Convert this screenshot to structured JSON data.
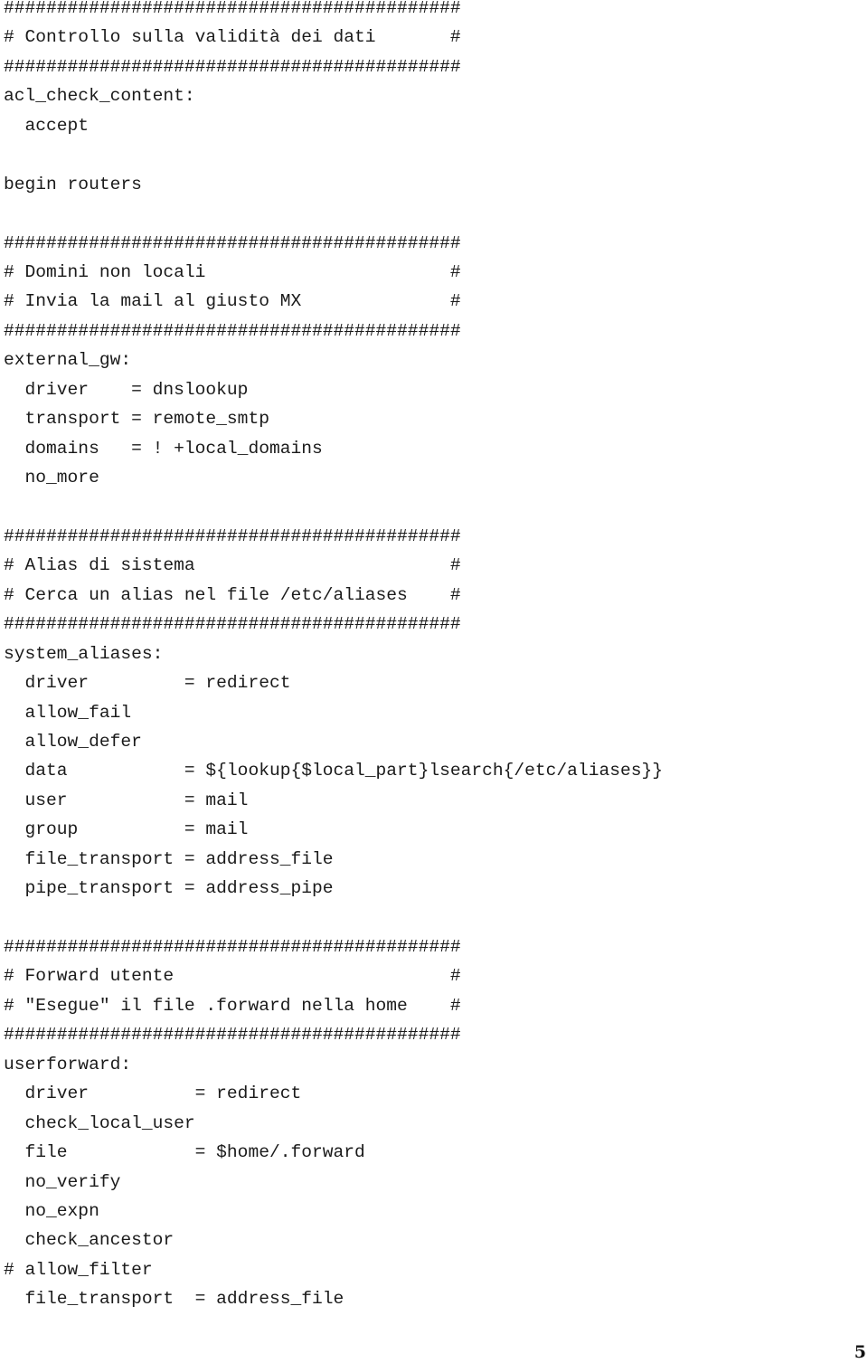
{
  "document": {
    "lines": [
      "###########################################",
      "# Controllo sulla validità dei dati       #",
      "###########################################",
      "acl_check_content:",
      "  accept",
      "",
      "begin routers",
      "",
      "###########################################",
      "# Domini non locali                       #",
      "# Invia la mail al giusto MX              #",
      "###########################################",
      "external_gw:",
      "  driver    = dnslookup",
      "  transport = remote_smtp",
      "  domains   = ! +local_domains",
      "  no_more",
      "",
      "###########################################",
      "# Alias di sistema                        #",
      "# Cerca un alias nel file /etc/aliases    #",
      "###########################################",
      "system_aliases:",
      "  driver         = redirect",
      "  allow_fail",
      "  allow_defer",
      "  data           = ${lookup{$local_part}lsearch{/etc/aliases}}",
      "  user           = mail",
      "  group          = mail",
      "  file_transport = address_file",
      "  pipe_transport = address_pipe",
      "",
      "###########################################",
      "# Forward utente                          #",
      "# \"Esegue\" il file .forward nella home    #",
      "###########################################",
      "userforward:",
      "  driver          = redirect",
      "  check_local_user",
      "  file            = $home/.forward",
      "  no_verify",
      "  no_expn",
      "  check_ancestor",
      "# allow_filter",
      "  file_transport  = address_file"
    ],
    "page_number": "5"
  }
}
